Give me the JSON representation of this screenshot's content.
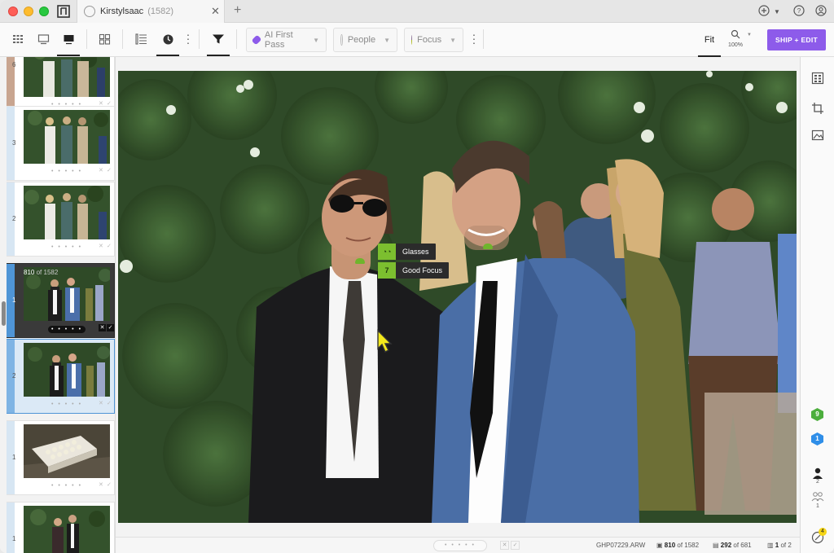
{
  "window": {
    "tab_title": "Kirstylsaac",
    "tab_count": "(1582)"
  },
  "toolbar": {
    "ai_first_pass": "AI First Pass",
    "people": "People",
    "focus": "Focus",
    "fit": "Fit",
    "zoom_pct": "100%",
    "ship_edit": "SHIP + EDIT"
  },
  "filmstrip": {
    "frames": [
      {
        "num": "6",
        "rating": "• • • • •"
      },
      {
        "num": "3",
        "rating": "• • • • •"
      },
      {
        "num": "2",
        "rating": "• • • • •"
      },
      {
        "num": "1",
        "rating": "• • • • •",
        "sel_index": "810",
        "sel_of": "of 1582"
      },
      {
        "num": "2",
        "rating": "• • • • •"
      },
      {
        "num": "1",
        "rating": "• • • • •"
      },
      {
        "num": "1",
        "rating": ""
      }
    ]
  },
  "tags": {
    "glasses": "Glasses",
    "good_focus_count": "7",
    "good_focus": "Good Focus"
  },
  "statusbar": {
    "rating": "• • • • •",
    "filename": "GHP07229.ARW",
    "index": "810",
    "index_of": "of 1582",
    "filtered": "292",
    "filtered_of": "of 681",
    "page": "1",
    "page_of": "of 2"
  },
  "rail": {
    "badge_green": "9",
    "badge_blue": "1",
    "people_count": "2",
    "group_count": "1",
    "notif_count": "4"
  },
  "colors": {
    "accent_purple": "#8d5bea",
    "tag_green": "#7cbf2f",
    "selection_blue": "#4f95d6"
  }
}
